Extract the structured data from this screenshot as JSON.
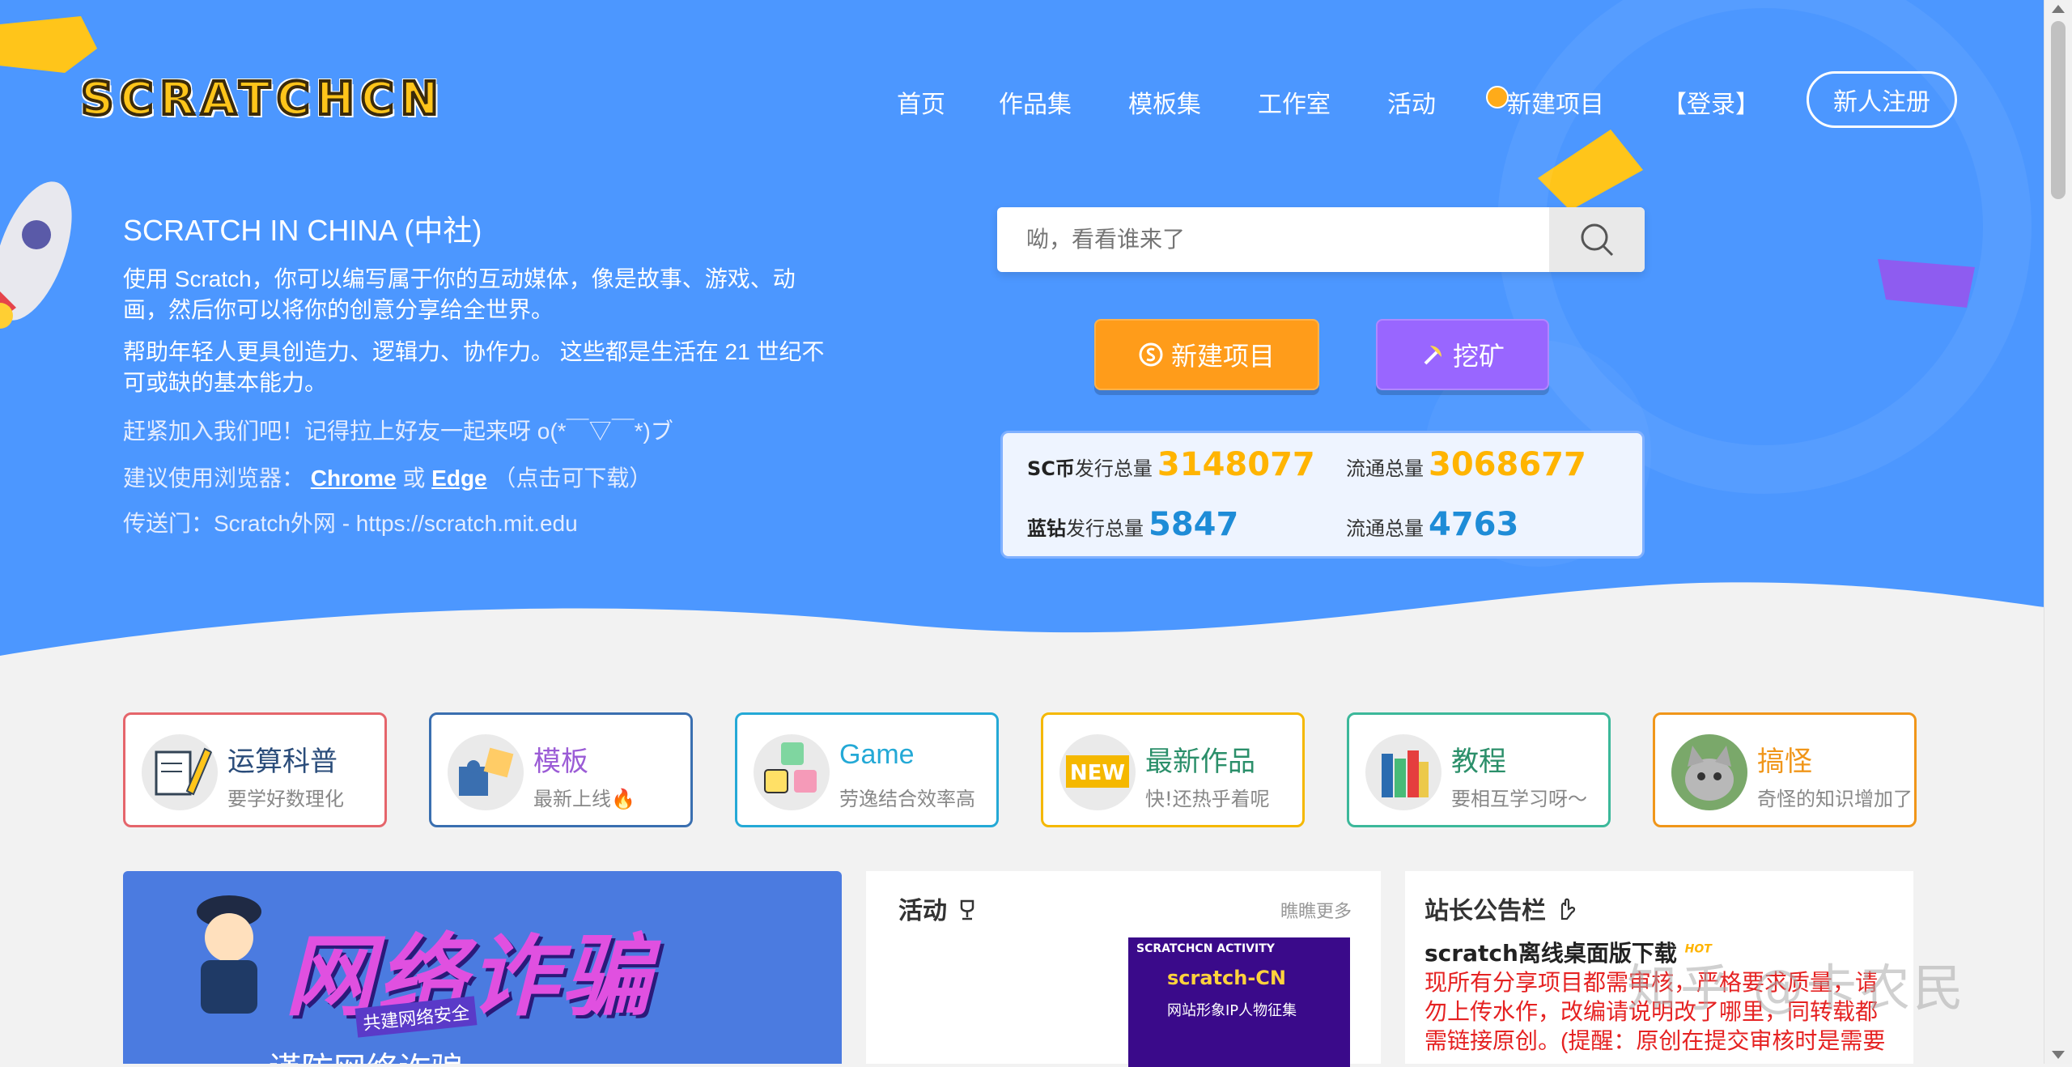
{
  "brand": {
    "logo_text": "SCRATCHCN"
  },
  "nav": {
    "home": "首页",
    "works": "作品集",
    "templates": "模板集",
    "studio": "工作室",
    "events": "活动",
    "new_project": "新建项目",
    "login": "【登录】",
    "register": "新人注册"
  },
  "intro": {
    "title": "SCRATCH IN CHINA (中社)",
    "p1": "使用 Scratch，你可以编写属于你的互动媒体，像是故事、游戏、动画，然后你可以将你的创意分享给全世界。",
    "p2": "帮助年轻人更具创造力、逻辑力、协作力。 这些都是生活在 21 世纪不可或缺的基本能力。",
    "join": "赶紧加入我们吧！记得拉上好友一起来呀 o(*￣▽￣*)ブ",
    "browser_prefix": "建议使用浏览器：",
    "browser_chrome": "Chrome",
    "browser_or": "或",
    "browser_edge": "Edge",
    "browser_suffix": "（点击可下载）",
    "portal": "传送门：Scratch外网 - https://scratch.mit.edu"
  },
  "search": {
    "placeholder": "呦，看看谁来了"
  },
  "actions": {
    "new_project": "新建项目",
    "mine": "挖矿"
  },
  "stats": {
    "sc_label_strong": "SC币",
    "issued_label": "发行总量",
    "circ_label": "流通总量",
    "sc_issued": "3148077",
    "sc_circ": "3068677",
    "diamond_label_strong": "蓝钻",
    "diamond_issued": "5847",
    "diamond_circ": "4763"
  },
  "categories": [
    {
      "title": "运算科普",
      "subtitle": "要学好数理化",
      "color": "#e5656b"
    },
    {
      "title": "模板",
      "subtitle": "最新上线🔥",
      "color": "#3a6fb0"
    },
    {
      "title": "Game",
      "subtitle": "劳逸结合效率高",
      "color": "#24a9d6"
    },
    {
      "title": "最新作品",
      "subtitle": "快!还热乎着呢",
      "color": "#f5b800"
    },
    {
      "title": "教程",
      "subtitle": "要相互学习呀～",
      "color": "#3cb89a"
    },
    {
      "title": "搞怪",
      "subtitle": "奇怪的知识增加了",
      "color": "#f0961a"
    }
  ],
  "banner": {
    "headline": "网络诈骗",
    "tagline": "共建网络安全",
    "caption": "谨防网络诈骗"
  },
  "activity": {
    "title": "活动",
    "more": "瞧瞧更多",
    "poster_tag": "SCRATCHCN ACTIVITY",
    "poster_title": "scratch-CN",
    "poster_sub": "网站形象IP人物征集"
  },
  "notice": {
    "title": "站长公告栏",
    "item_title": "scratch离线桌面版下载",
    "hot": "HOT",
    "text": "现所有分享项目都需审核，严格要求质量，请勿上传水作，改编请说明改了哪里，同转载都需链接原创。(提醒：原创在提交审核时是需要"
  },
  "watermark": "知乎 @卡农民",
  "colors": {
    "hero": "#4c97ff",
    "orange": "#ff9c1a",
    "purple": "#9966ff",
    "gold": "#ffb400",
    "blue": "#1e8cd7"
  }
}
